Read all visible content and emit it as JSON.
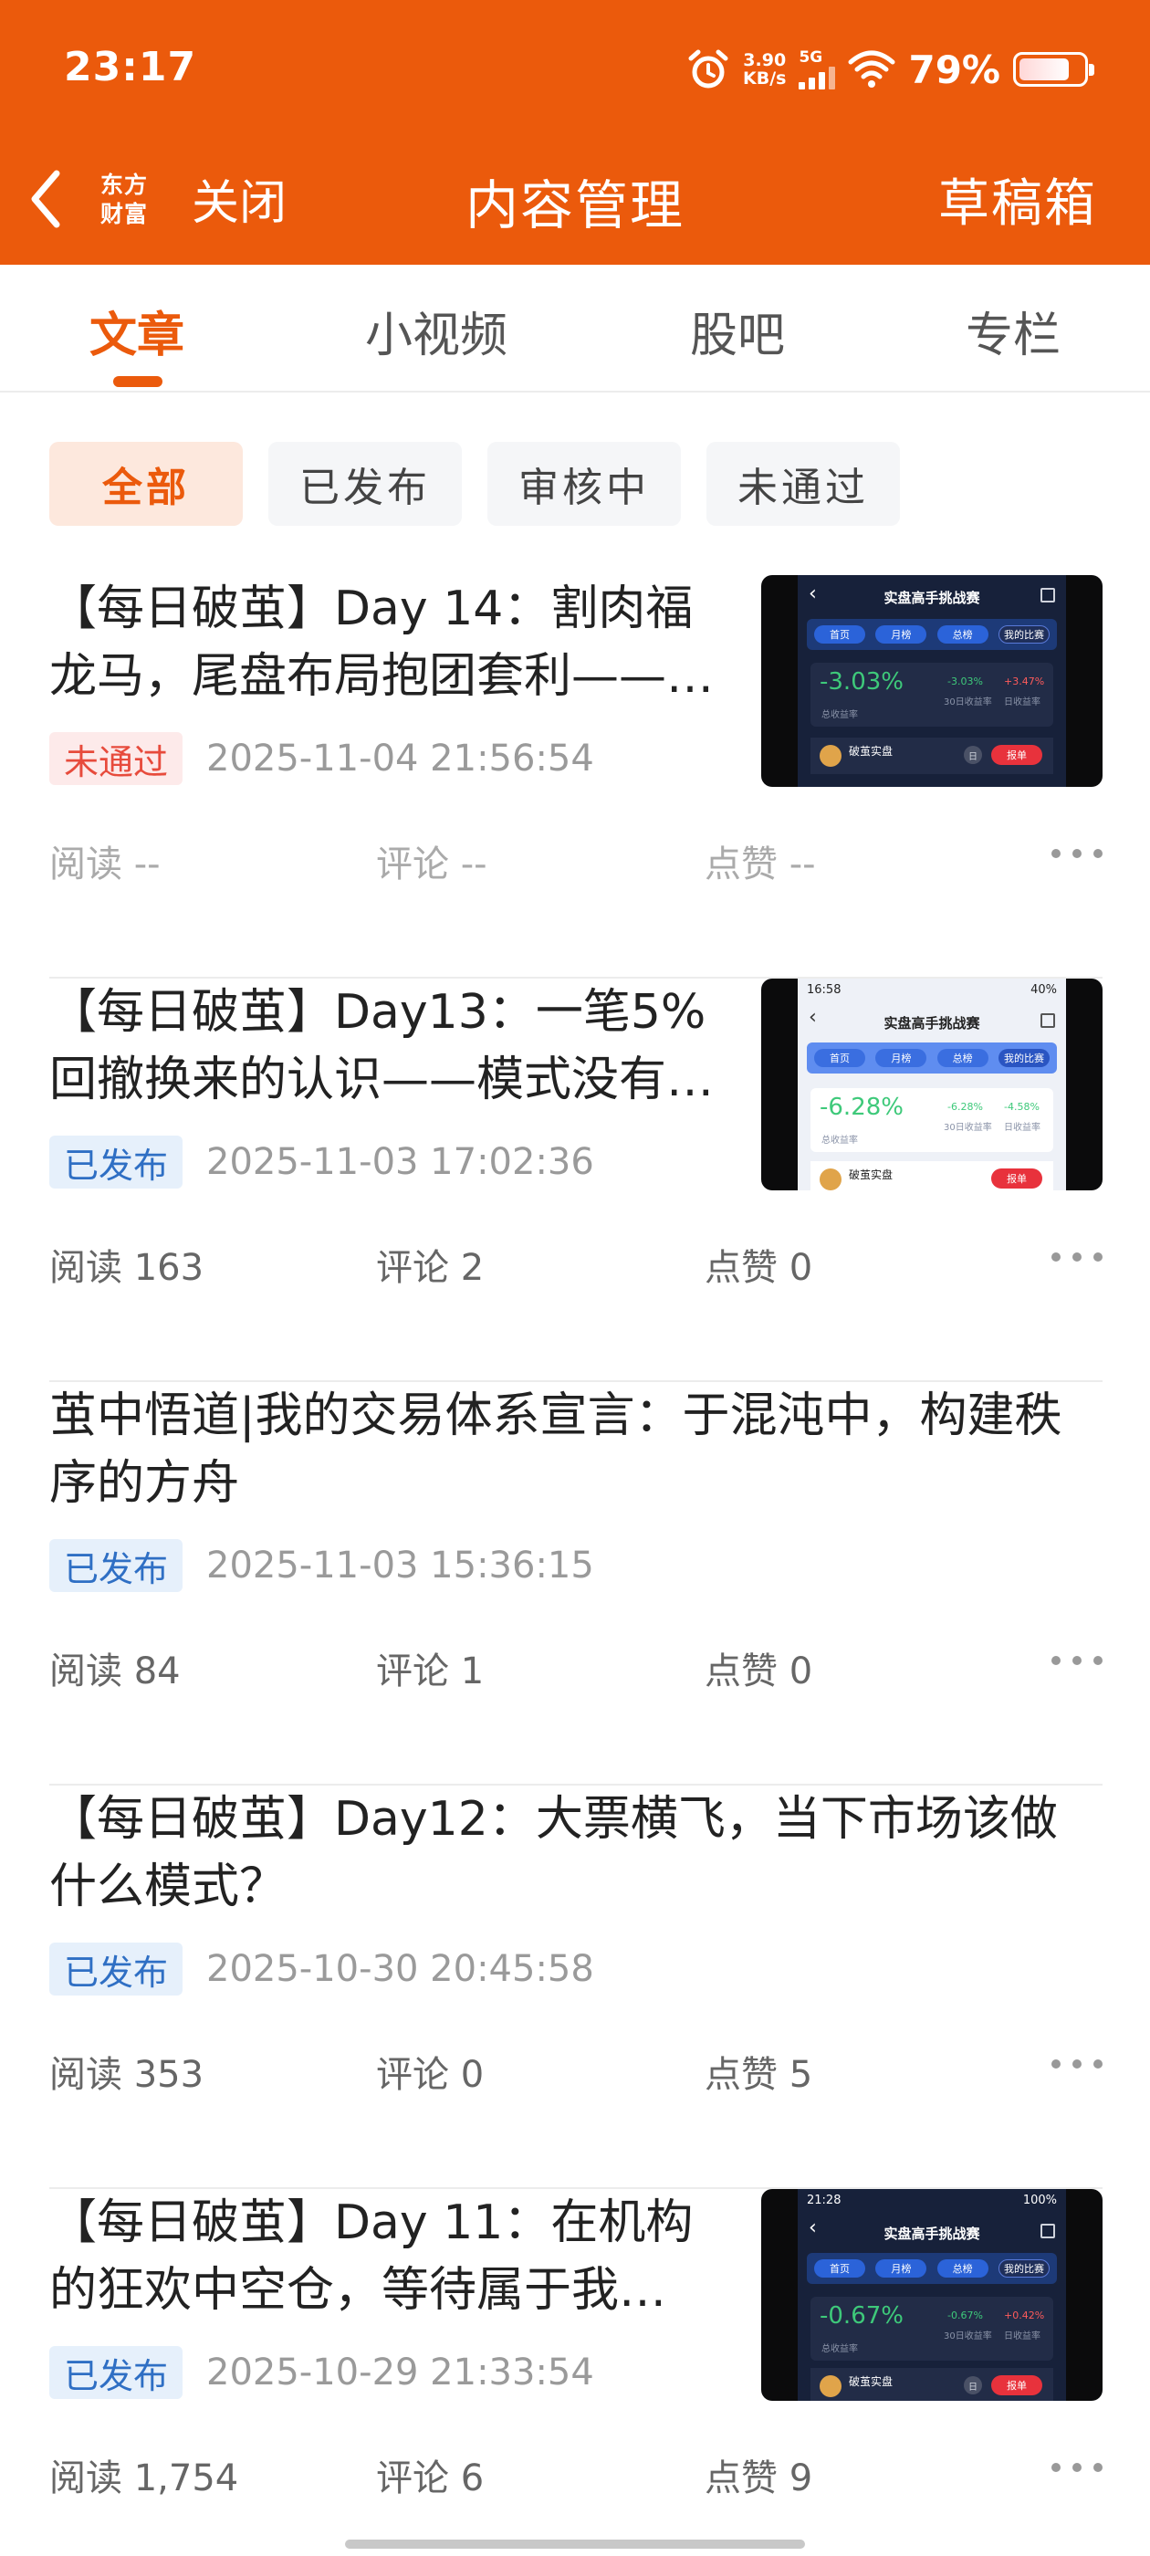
{
  "status_bar": {
    "time": "23:17",
    "net_speed_value": "3.90",
    "net_speed_unit": "KB/s",
    "network": "5G",
    "battery_percent": "79%",
    "battery_level": 0.79
  },
  "navbar": {
    "logo_line1": "东方",
    "logo_line2": "财富",
    "close_label": "关闭",
    "title": "内容管理",
    "drafts_label": "草稿箱"
  },
  "tabs": [
    {
      "label": "文章",
      "active": true
    },
    {
      "label": "小视频",
      "active": false
    },
    {
      "label": "股吧",
      "active": false
    },
    {
      "label": "专栏",
      "active": false
    }
  ],
  "filters": [
    {
      "label": "全部",
      "active": true
    },
    {
      "label": "已发布",
      "active": false
    },
    {
      "label": "审核中",
      "active": false
    },
    {
      "label": "未通过",
      "active": false
    }
  ],
  "articles": [
    {
      "title_line1": "【每日破茧】Day 14：割肉福",
      "title_line2": "龙马，尾盘布局抱团套利——…",
      "status": "未通过",
      "time": "2025-11-04 21:56:54",
      "read": "阅读 --",
      "comment": "评论 --",
      "like": "点赞 --",
      "thumb": {
        "title": "实盘高手挑战赛",
        "tabs": [
          "首页",
          "月榜",
          "总榜",
          "我的比赛"
        ],
        "big_value": "-3.03%",
        "big_label": "总收益率",
        "small1_value": "-3.03%",
        "small1_label": "30日收益率",
        "small2_value": "+3.47%",
        "small2_label": "日收益率",
        "user": "破茧实盘",
        "button": "报单"
      }
    },
    {
      "title_line1": "【每日破茧】Day13：一笔5%",
      "title_line2": "回撤换来的认识——模式没有…",
      "status": "已发布",
      "time": "2025-11-03 17:02:36",
      "read": "阅读 163",
      "comment": "评论 2",
      "like": "点赞 0",
      "thumb": {
        "status_time": "16:58",
        "status_right": "40%",
        "title": "实盘高手挑战赛",
        "tabs": [
          "首页",
          "月榜",
          "总榜",
          "我的比赛"
        ],
        "big_value": "-6.28%",
        "big_label": "总收益率",
        "small1_value": "-6.28%",
        "small1_label": "30日收益率",
        "small2_value": "-4.58%",
        "small2_label": "日收益率",
        "user": "破茧实盘",
        "button": "报单"
      }
    },
    {
      "title_line1": "茧中悟道|我的交易体系宣言：于混沌中，构建秩",
      "title_line2": "序的方舟",
      "status": "已发布",
      "time": "2025-11-03 15:36:15",
      "read": "阅读 84",
      "comment": "评论 1",
      "like": "点赞 0"
    },
    {
      "title_line1": "【每日破茧】Day12：大票横飞，当下市场该做",
      "title_line2": "什么模式？",
      "status": "已发布",
      "time": "2025-10-30 20:45:58",
      "read": "阅读 353",
      "comment": "评论 0",
      "like": "点赞 5"
    },
    {
      "title_line1": "【每日破茧】Day 11：在机构",
      "title_line2": "的狂欢中空仓，等待属于我…",
      "status": "已发布",
      "time": "2025-10-29 21:33:54",
      "read": "阅读 1,754",
      "comment": "评论 6",
      "like": "点赞 9",
      "thumb": {
        "status_time": "21:28",
        "status_right": "100%",
        "title": "实盘高手挑战赛",
        "tabs": [
          "首页",
          "月榜",
          "总榜",
          "我的比赛"
        ],
        "big_value": "-0.67%",
        "big_label": "总收益率",
        "small1_value": "-0.67%",
        "small1_label": "30日收益率",
        "small2_value": "+0.42%",
        "small2_label": "日收益率",
        "user": "破茧实盘",
        "button": "报单"
      }
    }
  ],
  "colors": {
    "brand": "#EB5A0C",
    "rejected": "#E74B3C",
    "published": "#2F6FC4"
  },
  "icons": [
    "back-arrow-icon",
    "alarm-icon",
    "signal-icon",
    "wifi-icon",
    "battery-icon",
    "more-dots-icon"
  ]
}
